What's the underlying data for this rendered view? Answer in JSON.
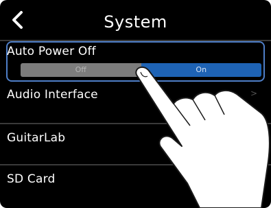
{
  "header": {
    "title": "System",
    "back_icon": "chevron-left-icon"
  },
  "items": [
    {
      "label": "Auto Power Off"
    },
    {
      "label": "Audio Interface"
    },
    {
      "label": "GuitarLab"
    },
    {
      "label": "SD Card"
    }
  ],
  "toggle": {
    "off_label": "Off",
    "on_label": "On",
    "selected": "On"
  },
  "chevron": ">",
  "colors": {
    "highlight": "#4f7fc8",
    "on": "#1e63b5",
    "off": "#7c7c7c"
  }
}
